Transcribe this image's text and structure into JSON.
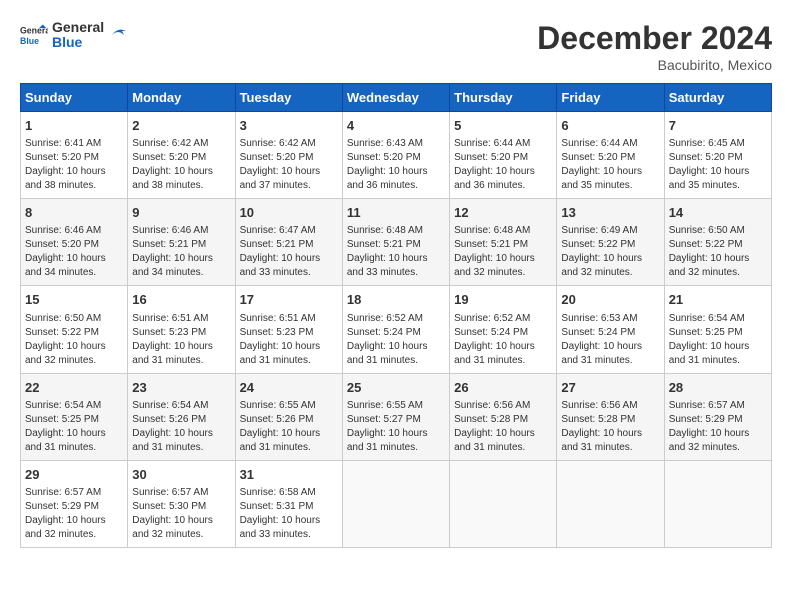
{
  "header": {
    "logo_general": "General",
    "logo_blue": "Blue",
    "month": "December 2024",
    "location": "Bacubirito, Mexico"
  },
  "days_of_week": [
    "Sunday",
    "Monday",
    "Tuesday",
    "Wednesday",
    "Thursday",
    "Friday",
    "Saturday"
  ],
  "weeks": [
    [
      {
        "day": 1,
        "info": "Sunrise: 6:41 AM\nSunset: 5:20 PM\nDaylight: 10 hours\nand 38 minutes."
      },
      {
        "day": 2,
        "info": "Sunrise: 6:42 AM\nSunset: 5:20 PM\nDaylight: 10 hours\nand 38 minutes."
      },
      {
        "day": 3,
        "info": "Sunrise: 6:42 AM\nSunset: 5:20 PM\nDaylight: 10 hours\nand 37 minutes."
      },
      {
        "day": 4,
        "info": "Sunrise: 6:43 AM\nSunset: 5:20 PM\nDaylight: 10 hours\nand 36 minutes."
      },
      {
        "day": 5,
        "info": "Sunrise: 6:44 AM\nSunset: 5:20 PM\nDaylight: 10 hours\nand 36 minutes."
      },
      {
        "day": 6,
        "info": "Sunrise: 6:44 AM\nSunset: 5:20 PM\nDaylight: 10 hours\nand 35 minutes."
      },
      {
        "day": 7,
        "info": "Sunrise: 6:45 AM\nSunset: 5:20 PM\nDaylight: 10 hours\nand 35 minutes."
      }
    ],
    [
      {
        "day": 8,
        "info": "Sunrise: 6:46 AM\nSunset: 5:20 PM\nDaylight: 10 hours\nand 34 minutes."
      },
      {
        "day": 9,
        "info": "Sunrise: 6:46 AM\nSunset: 5:21 PM\nDaylight: 10 hours\nand 34 minutes."
      },
      {
        "day": 10,
        "info": "Sunrise: 6:47 AM\nSunset: 5:21 PM\nDaylight: 10 hours\nand 33 minutes."
      },
      {
        "day": 11,
        "info": "Sunrise: 6:48 AM\nSunset: 5:21 PM\nDaylight: 10 hours\nand 33 minutes."
      },
      {
        "day": 12,
        "info": "Sunrise: 6:48 AM\nSunset: 5:21 PM\nDaylight: 10 hours\nand 32 minutes."
      },
      {
        "day": 13,
        "info": "Sunrise: 6:49 AM\nSunset: 5:22 PM\nDaylight: 10 hours\nand 32 minutes."
      },
      {
        "day": 14,
        "info": "Sunrise: 6:50 AM\nSunset: 5:22 PM\nDaylight: 10 hours\nand 32 minutes."
      }
    ],
    [
      {
        "day": 15,
        "info": "Sunrise: 6:50 AM\nSunset: 5:22 PM\nDaylight: 10 hours\nand 32 minutes."
      },
      {
        "day": 16,
        "info": "Sunrise: 6:51 AM\nSunset: 5:23 PM\nDaylight: 10 hours\nand 31 minutes."
      },
      {
        "day": 17,
        "info": "Sunrise: 6:51 AM\nSunset: 5:23 PM\nDaylight: 10 hours\nand 31 minutes."
      },
      {
        "day": 18,
        "info": "Sunrise: 6:52 AM\nSunset: 5:24 PM\nDaylight: 10 hours\nand 31 minutes."
      },
      {
        "day": 19,
        "info": "Sunrise: 6:52 AM\nSunset: 5:24 PM\nDaylight: 10 hours\nand 31 minutes."
      },
      {
        "day": 20,
        "info": "Sunrise: 6:53 AM\nSunset: 5:24 PM\nDaylight: 10 hours\nand 31 minutes."
      },
      {
        "day": 21,
        "info": "Sunrise: 6:54 AM\nSunset: 5:25 PM\nDaylight: 10 hours\nand 31 minutes."
      }
    ],
    [
      {
        "day": 22,
        "info": "Sunrise: 6:54 AM\nSunset: 5:25 PM\nDaylight: 10 hours\nand 31 minutes."
      },
      {
        "day": 23,
        "info": "Sunrise: 6:54 AM\nSunset: 5:26 PM\nDaylight: 10 hours\nand 31 minutes."
      },
      {
        "day": 24,
        "info": "Sunrise: 6:55 AM\nSunset: 5:26 PM\nDaylight: 10 hours\nand 31 minutes."
      },
      {
        "day": 25,
        "info": "Sunrise: 6:55 AM\nSunset: 5:27 PM\nDaylight: 10 hours\nand 31 minutes."
      },
      {
        "day": 26,
        "info": "Sunrise: 6:56 AM\nSunset: 5:28 PM\nDaylight: 10 hours\nand 31 minutes."
      },
      {
        "day": 27,
        "info": "Sunrise: 6:56 AM\nSunset: 5:28 PM\nDaylight: 10 hours\nand 31 minutes."
      },
      {
        "day": 28,
        "info": "Sunrise: 6:57 AM\nSunset: 5:29 PM\nDaylight: 10 hours\nand 32 minutes."
      }
    ],
    [
      {
        "day": 29,
        "info": "Sunrise: 6:57 AM\nSunset: 5:29 PM\nDaylight: 10 hours\nand 32 minutes."
      },
      {
        "day": 30,
        "info": "Sunrise: 6:57 AM\nSunset: 5:30 PM\nDaylight: 10 hours\nand 32 minutes."
      },
      {
        "day": 31,
        "info": "Sunrise: 6:58 AM\nSunset: 5:31 PM\nDaylight: 10 hours\nand 33 minutes."
      },
      null,
      null,
      null,
      null
    ]
  ]
}
